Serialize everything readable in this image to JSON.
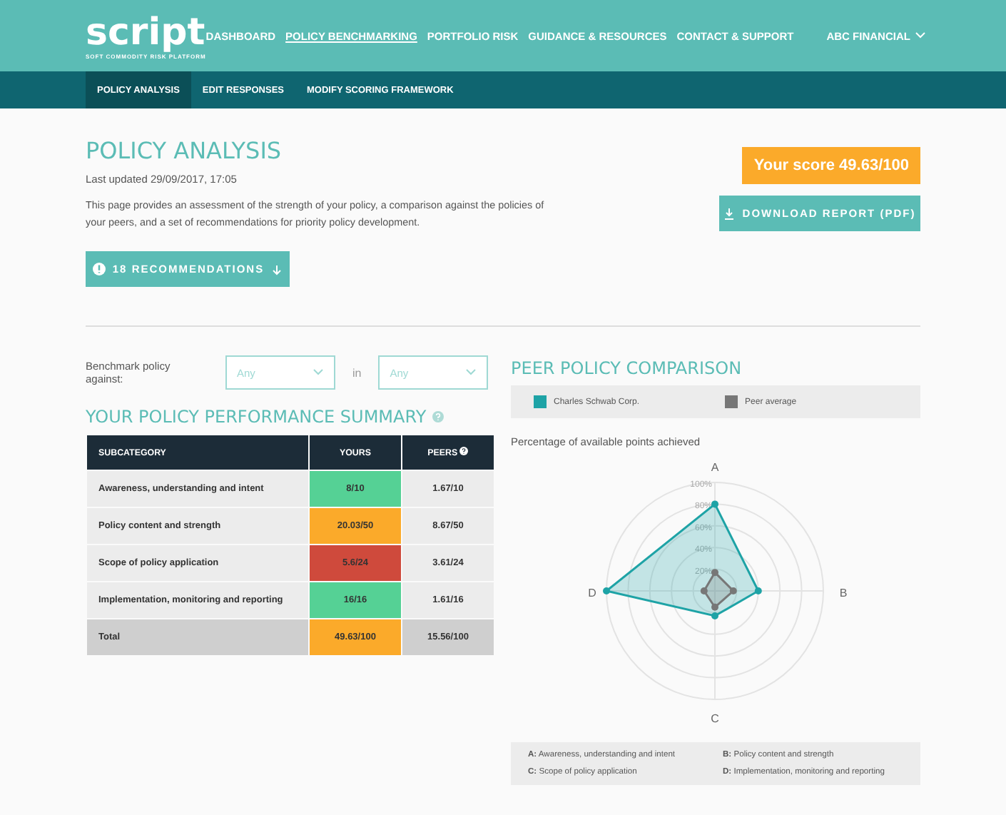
{
  "header": {
    "logo": "script",
    "tagline": "SOFT COMMODITY RISK PLATFORM",
    "nav": [
      {
        "label": "DASHBOARD",
        "selected": false
      },
      {
        "label": "POLICY BENCHMARKING",
        "selected": true
      },
      {
        "label": "PORTFOLIO RISK",
        "selected": false
      },
      {
        "label": "GUIDANCE & RESOURCES",
        "selected": false
      },
      {
        "label": "CONTACT & SUPPORT",
        "selected": false
      }
    ],
    "account": "ABC FINANCIAL"
  },
  "subnav": [
    {
      "label": "POLICY ANALYSIS",
      "selected": true
    },
    {
      "label": "EDIT RESPONSES",
      "selected": false
    },
    {
      "label": "MODIFY SCORING FRAMEWORK",
      "selected": false
    }
  ],
  "page": {
    "title": "POLICY ANALYSIS",
    "updated": "Last updated 29/09/2017, 17:05",
    "description": "This page provides an assessment of the strength of your policy, a comparison against the policies of your peers, and a set of recommendations for priority policy development.",
    "recommendations_button": "18 RECOMMENDATIONS",
    "score": "Your score 49.63/100",
    "download_button": "DOWNLOAD REPORT (PDF)"
  },
  "benchmark": {
    "label": "Benchmark policy against:",
    "first": "Any",
    "joiner": "in",
    "second": "Any"
  },
  "summary": {
    "title": "YOUR POLICY PERFORMANCE SUMMARY",
    "columns": [
      "SUBCATEGORY",
      "YOURS",
      "PEERS"
    ],
    "rows": [
      {
        "subcategory": "Awareness, understanding and intent",
        "yours": "8/10",
        "color": "#55d195",
        "peers": "1.67/10",
        "kind": "row"
      },
      {
        "subcategory": "Policy content and strength",
        "yours": "20.03/50",
        "color": "#fbaa2a",
        "peers": "8.67/50",
        "kind": "row"
      },
      {
        "subcategory": "Scope of policy application",
        "yours": "5.6/24",
        "color": "#cf4a3c",
        "peers": "3.61/24",
        "kind": "row"
      },
      {
        "subcategory": "Implementation, monitoring and reporting",
        "yours": "16/16",
        "color": "#55d195",
        "peers": "1.61/16",
        "kind": "row"
      },
      {
        "subcategory": "Total",
        "yours": "49.63/100",
        "color": "#fbaa2a",
        "peers": "15.56/100",
        "kind": "total"
      }
    ]
  },
  "comparison": {
    "title": "PEER POLICY COMPARISON",
    "subtitle": "Percentage of available points achieved",
    "legend": [
      {
        "name": "Charles Schwab Corp.",
        "color": "#1ea3a6"
      },
      {
        "name": "Peer average",
        "color": "#777777"
      }
    ],
    "ring_labels": [
      "100%",
      "80%",
      "60%",
      "40%",
      "20%"
    ],
    "axis_labels": [
      "A",
      "B",
      "C",
      "D"
    ],
    "key": [
      "**A:** Awareness, understanding and intent",
      "**B:** Policy content and strength",
      "**C:** Scope of policy application",
      "**D:** Implementation, monitoring and reporting"
    ]
  }
}
